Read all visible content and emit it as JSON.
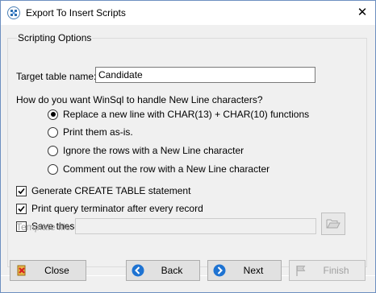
{
  "window": {
    "title": "Export To Insert Scripts",
    "close_glyph": "✕"
  },
  "group": {
    "legend": "Scripting Options"
  },
  "target": {
    "label": "Target table name:",
    "value": "Candidate"
  },
  "newline": {
    "question": "How do you want WinSql to handle New Line characters?",
    "options": [
      {
        "label": "Replace a new line with CHAR(13) + CHAR(10) functions",
        "selected": true
      },
      {
        "label": "Print them as-is.",
        "selected": false
      },
      {
        "label": "Ignore the rows with a New Line character",
        "selected": false
      },
      {
        "label": "Comment out the row with a New Line character",
        "selected": false
      }
    ]
  },
  "checkboxes": [
    {
      "label": "Generate CREATE TABLE statement",
      "checked": true
    },
    {
      "label": "Print query terminator after every record",
      "checked": true
    },
    {
      "label": "Save these settings to a template file for future use",
      "checked": false
    }
  ],
  "template": {
    "label": "Template file:",
    "value": ""
  },
  "buttons": {
    "close": "Close",
    "back": "Back",
    "next": "Next",
    "finish": "Finish"
  },
  "colors": {
    "window_border": "#6d8fc0",
    "client_bg": "#f0f0f0",
    "button_bg": "#e1e1e1",
    "nav_icon_blue": "#1e73d2"
  }
}
